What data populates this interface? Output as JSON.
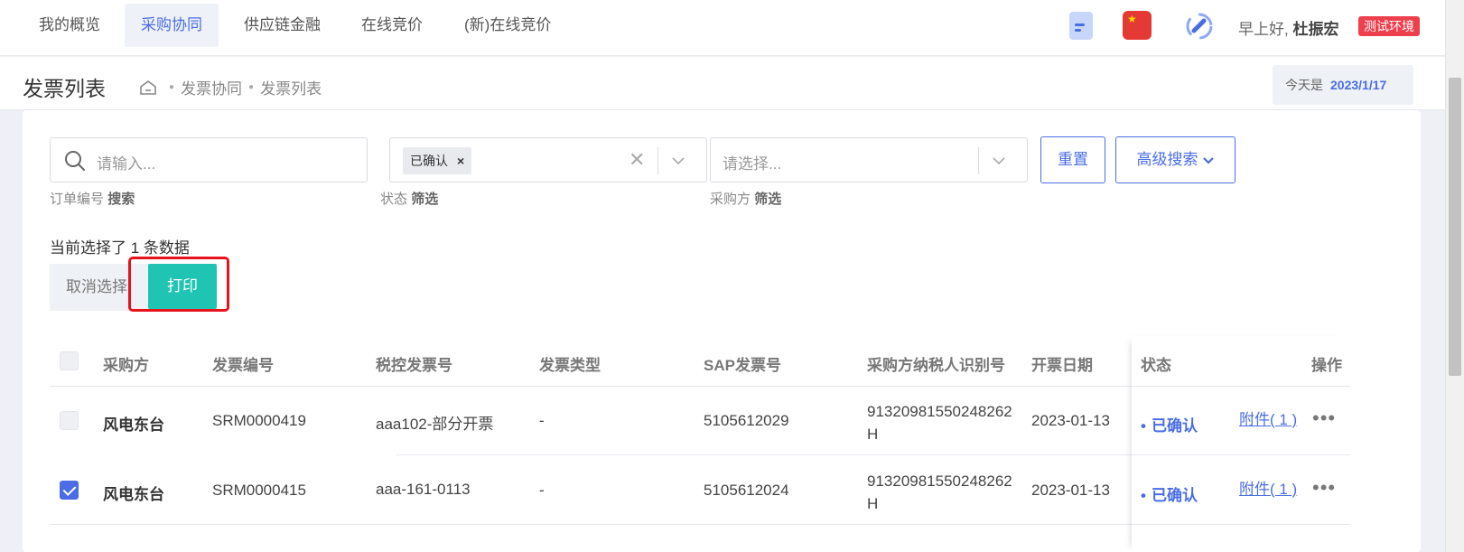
{
  "topnav": {
    "items": [
      {
        "label": "我的概览",
        "active": false
      },
      {
        "label": "采购协同",
        "active": true
      },
      {
        "label": "供应链金融",
        "active": false
      },
      {
        "label": "在线竞价",
        "active": false
      },
      {
        "label": "(新)在线竞价",
        "active": false
      }
    ],
    "greeting_prefix": "早上好,",
    "user_name": "杜振宏",
    "env_badge": "测试环境",
    "icons": [
      "document-icon",
      "china-flag-icon",
      "phone-icon"
    ]
  },
  "page": {
    "title": "发票列表",
    "breadcrumb": [
      "发票协同",
      "发票列表"
    ],
    "today_label": "今天是",
    "today_value": "2023/1/17"
  },
  "filters": {
    "order_search": {
      "placeholder": "请输入...",
      "hint_prefix": "订单编号",
      "hint_action": "搜索"
    },
    "status": {
      "selected_tag": "已确认",
      "hint_prefix": "状态",
      "hint_action": "筛选"
    },
    "buyer": {
      "placeholder": "请选择...",
      "hint_prefix": "采购方",
      "hint_action": "筛选"
    },
    "reset_label": "重置",
    "advanced_label": "高级搜索"
  },
  "selection": {
    "info": "当前选择了 1 条数据",
    "cancel_label": "取消选择",
    "print_label": "打印"
  },
  "table": {
    "columns": [
      "采购方",
      "发票编号",
      "税控发票号",
      "发票类型",
      "SAP发票号",
      "采购方纳税人识别号",
      "开票日期",
      "状态",
      "操作"
    ],
    "rows": [
      {
        "checked": false,
        "buyer": "风电东台",
        "invoice_no": "SRM0000419",
        "tax_invoice_no": "aaa102-部分开票",
        "invoice_type": "-",
        "sap_no": "5105612029",
        "taxpayer_id": "91320981550248262H",
        "date": "2023-01-13",
        "status": "已确认",
        "attachment": "附件( 1 )",
        "more": "•••"
      },
      {
        "checked": true,
        "buyer": "风电东台",
        "invoice_no": "SRM0000415",
        "tax_invoice_no": "aaa-161-0113",
        "invoice_type": "-",
        "sap_no": "5105612024",
        "taxpayer_id": "91320981550248262H",
        "date": "2023-01-13",
        "status": "已确认",
        "attachment": "附件( 1 )",
        "more": "•••"
      }
    ]
  },
  "colors": {
    "accent": "#4a6de5",
    "print_button": "#20c4b3",
    "badge": "#ee3f4d",
    "highlight": "#e8121b"
  }
}
